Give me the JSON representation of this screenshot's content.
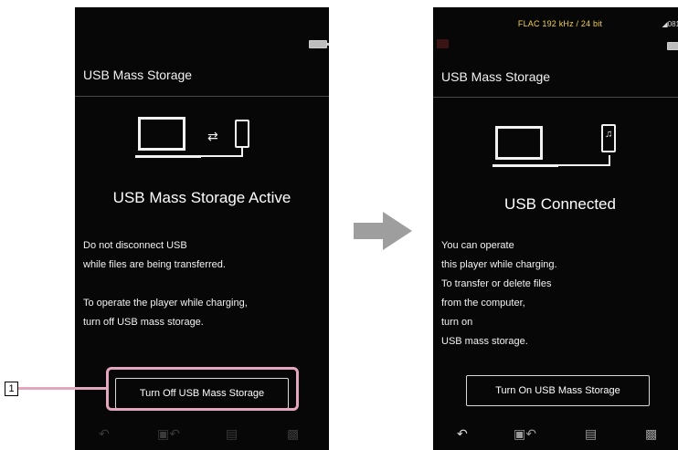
{
  "left_screen": {
    "title": "USB Mass Storage",
    "transfer_icon": "⇄",
    "heading": "USB Mass Storage Active",
    "message_lines": [
      "Do not disconnect USB",
      "while files are being transferred.",
      "",
      "To operate the player while charging,",
      "turn off USB mass storage."
    ],
    "button_label": "Turn Off USB Mass Storage",
    "nav_icons": [
      "back-icon",
      "playback-icon",
      "library-icon",
      "options-icon"
    ]
  },
  "right_screen": {
    "status_text": "FLAC 192 kHz / 24 bit",
    "signal_text": "◢081",
    "title": "USB Mass Storage",
    "music_note": "♫",
    "heading": "USB Connected",
    "message_lines": [
      "You can operate",
      "this player while charging.",
      "To transfer or delete files",
      "from the computer,",
      "turn on",
      "USB mass storage."
    ],
    "button_label": "Turn On USB Mass Storage",
    "nav_icons": [
      "back-icon",
      "playback-icon",
      "library-icon",
      "options-icon"
    ]
  },
  "callout": {
    "number": "1"
  },
  "colors": {
    "screen_bg": "#070707",
    "status_text": "#f1d24b",
    "callout": "#e4a6be",
    "arrow": "#9e9e9e"
  }
}
